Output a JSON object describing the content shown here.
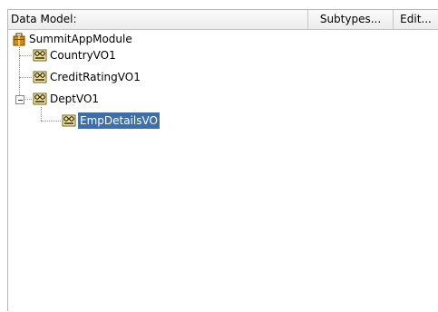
{
  "header": {
    "title": "Data Model:",
    "subtypes_label": "Subtypes...",
    "edit_label": "Edit..."
  },
  "tree": {
    "root": {
      "label": "SummitAppModule",
      "icon": "application-module-icon"
    },
    "children": [
      {
        "label": "CountryVO1",
        "icon": "view-object-icon"
      },
      {
        "label": "CreditRatingVO1",
        "icon": "view-object-icon"
      },
      {
        "label": "DeptVO1",
        "icon": "view-object-icon",
        "expanded": true,
        "children": [
          {
            "label": "EmpDetailsVO",
            "icon": "view-object-icon",
            "selected": true
          }
        ]
      }
    ]
  },
  "colors": {
    "selection_background": "#3b6fae",
    "selection_text": "#ffffff",
    "module_icon": "#c8860b"
  }
}
